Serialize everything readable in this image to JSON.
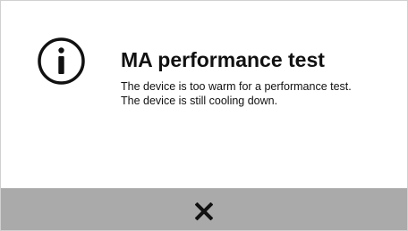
{
  "dialog": {
    "icon": "info-icon",
    "title": "MA performance test",
    "message_lines": [
      "The device is too warm for a performance test.",
      "The device is still cooling down."
    ],
    "footer": {
      "close_icon": "close-icon",
      "background_color": "#aaaaaa"
    }
  }
}
